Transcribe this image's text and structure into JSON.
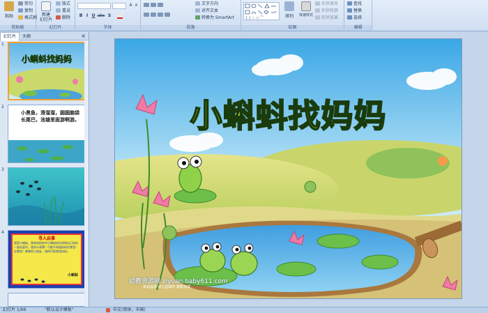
{
  "ribbon": {
    "clipboard": {
      "paste": "粘贴",
      "cut": "剪切",
      "copy": "复制",
      "format_painter": "格式刷",
      "label": "剪贴板"
    },
    "slides": {
      "new_slide": "新建\n幻灯片",
      "layout": "版式",
      "reset": "重设",
      "delete": "删除",
      "label": "幻灯片"
    },
    "font": {
      "font_name": "",
      "font_size": "",
      "bold": "B",
      "italic": "I",
      "underline": "U",
      "strike": "abc",
      "shadow": "S",
      "label": "字体"
    },
    "paragraph": {
      "text_direction": "文字方向",
      "align_text": "对齐文本",
      "smartart": "转换为 SmartArt",
      "label": "段落"
    },
    "drawing": {
      "arrange": "排列",
      "quick_styles": "快速样式",
      "shape_fill": "形状填充",
      "shape_outline": "形状轮廓",
      "shape_effects": "形状效果",
      "label": "绘图"
    },
    "editing": {
      "find": "查找",
      "replace": "替换",
      "select": "选择",
      "label": "编辑"
    }
  },
  "panel": {
    "tabs": [
      "幻灯片",
      "大纲"
    ],
    "close": "×",
    "slides": [
      {
        "num": "1",
        "title": "小蝌蚪找妈妈",
        "text": ""
      },
      {
        "num": "2",
        "title": "",
        "text": "小黑鱼，滑溜溜，圆圆脑袋长尾巴，池塘里面游啊游。"
      },
      {
        "num": "3",
        "title": "",
        "text": ""
      },
      {
        "num": "4",
        "title": "寻人启事",
        "text": "我是小蝌蚪，我有妈妈的中小蝌蚪快乐地和自己妈妈一起玩耍时，我多么羡慕！可能不知道妈妈在哪里！在哪里！哪哪的小朋友，请你们帮我找妈妈。",
        "sign": "小蝌蚪"
      }
    ]
  },
  "slide": {
    "title": "小蝌蚪找妈妈",
    "watermark": "幼教资源网 ziyuan.baby611.com",
    "watermark_sub": "本站提供 幼儿园课件 教案资源"
  },
  "status": {
    "slide_indicator": "幻灯片 1/66",
    "theme": "\"默认设计模板\"",
    "language": "中文(简体，中国)"
  },
  "colors": {
    "accent": "#f0a030",
    "ribbon_bg": "#dbe6f4",
    "title_fill": "#f7f21a"
  }
}
